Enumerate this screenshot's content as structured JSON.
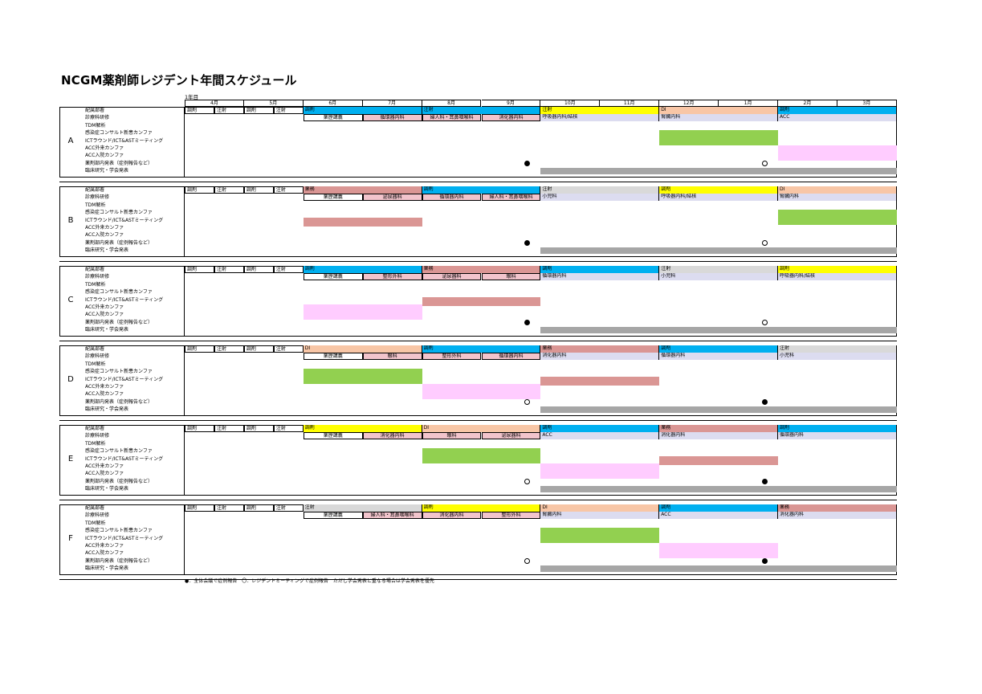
{
  "title": "NCGM薬剤師レジデント年間スケジュール",
  "year_label": "1年目",
  "months": [
    "4月",
    "5月",
    "6月",
    "7月",
    "8月",
    "9月",
    "10月",
    "11月",
    "12月",
    "1月",
    "2月",
    "3月"
  ],
  "row_labels": [
    "配属部署",
    "診療科研修",
    "TDM解析",
    "感染症コンサルト新患カンファ",
    "ICTラウンド/ICT&ASTミーティング",
    "ACC外来カンファ",
    "ACC入院カンファ",
    "薬剤部内発表（症例報告など）",
    "臨床研究・学会発表"
  ],
  "colors": {
    "blue": "#00b0f0",
    "yellow": "#ffff00",
    "salmon": "#f8c6a6",
    "rose": "#da9694",
    "lightgray": "#d9d9d9",
    "pink_cell": "#f2b8c6",
    "green": "#92d050",
    "lightpink": "#ffccff",
    "gray": "#a6a6a6",
    "lavender": "#dcdcf0"
  },
  "common_assignments": [
    "調剤",
    "注射",
    "調剤",
    "注射"
  ],
  "groups": [
    {
      "letter": "A",
      "assignments": [
        {
          "label": "調剤",
          "color": "blue"
        },
        {
          "label": "注射",
          "color": "blue"
        },
        {
          "label": "注射",
          "color": "yellow"
        },
        {
          "label": "DI",
          "color": "salmon"
        },
        {
          "label": "調剤",
          "color": "blue"
        }
      ],
      "rotations": [
        {
          "label": "薬歴講義",
          "style": "boxed"
        },
        {
          "label": "循環器内科",
          "style": "pink"
        },
        {
          "label": "婦人科・耳鼻咽喉科",
          "style": "pink"
        },
        {
          "label": "消化器内科",
          "style": "pink"
        },
        {
          "label": "呼吸器内科/結核",
          "style": "lav"
        },
        {
          "label": "腎臓内科",
          "style": "lav"
        },
        {
          "label": "ACC",
          "style": "lav"
        }
      ],
      "markers": [
        {
          "month": "9月",
          "type": "filled"
        },
        {
          "month": "1月",
          "type": "open"
        }
      ]
    },
    {
      "letter": "B",
      "assignments": [
        {
          "label": "薬務",
          "color": "rose"
        },
        {
          "label": "調剤",
          "color": "blue"
        },
        {
          "label": "注射",
          "color": "lightgray"
        },
        {
          "label": "調剤",
          "color": "yellow"
        },
        {
          "label": "DI",
          "color": "salmon"
        }
      ],
      "rotations": [
        {
          "label": "薬歴講義",
          "style": "boxed"
        },
        {
          "label": "泌尿器科",
          "style": "pink"
        },
        {
          "label": "循環器内科",
          "style": "pink"
        },
        {
          "label": "婦人科・耳鼻咽喉科",
          "style": "pink"
        },
        {
          "label": "小児科",
          "style": "lav"
        },
        {
          "label": "呼吸器内科/結核",
          "style": "lav"
        },
        {
          "label": "腎臓内科",
          "style": "lav"
        }
      ],
      "markers": [
        {
          "month": "9月",
          "type": "filled"
        },
        {
          "month": "1月",
          "type": "open"
        }
      ]
    },
    {
      "letter": "C",
      "assignments": [
        {
          "label": "調剤",
          "color": "blue"
        },
        {
          "label": "薬務",
          "color": "rose"
        },
        {
          "label": "調剤",
          "color": "blue"
        },
        {
          "label": "注射",
          "color": "lightgray"
        },
        {
          "label": "調剤",
          "color": "yellow"
        }
      ],
      "rotations": [
        {
          "label": "薬歴講義",
          "style": "boxed"
        },
        {
          "label": "整形外科",
          "style": "pink"
        },
        {
          "label": "泌尿器科",
          "style": "pink"
        },
        {
          "label": "眼科",
          "style": "pink"
        },
        {
          "label": "循環器内科",
          "style": "lav"
        },
        {
          "label": "小児科",
          "style": "lav"
        },
        {
          "label": "呼吸器内科/結核",
          "style": "lav"
        }
      ],
      "markers": [
        {
          "month": "9月",
          "type": "filled"
        },
        {
          "month": "1月",
          "type": "open"
        }
      ]
    },
    {
      "letter": "D",
      "assignments": [
        {
          "label": "DI",
          "color": "salmon"
        },
        {
          "label": "調剤",
          "color": "blue"
        },
        {
          "label": "薬務",
          "color": "rose"
        },
        {
          "label": "調剤",
          "color": "blue"
        },
        {
          "label": "注射",
          "color": "lightgray"
        }
      ],
      "rotations": [
        {
          "label": "薬歴講義",
          "style": "boxed"
        },
        {
          "label": "眼科",
          "style": "pink"
        },
        {
          "label": "整形外科",
          "style": "pink"
        },
        {
          "label": "循環器内科",
          "style": "pink"
        },
        {
          "label": "消化器内科",
          "style": "lav"
        },
        {
          "label": "循環器内科",
          "style": "lav"
        },
        {
          "label": "小児科",
          "style": "lav"
        }
      ],
      "markers": [
        {
          "month": "9月",
          "type": "open"
        },
        {
          "month": "1月",
          "type": "filled"
        }
      ]
    },
    {
      "letter": "E",
      "assignments": [
        {
          "label": "調剤",
          "color": "yellow"
        },
        {
          "label": "DI",
          "color": "salmon"
        },
        {
          "label": "調剤",
          "color": "blue"
        },
        {
          "label": "薬務",
          "color": "rose"
        },
        {
          "label": "調剤",
          "color": "blue"
        }
      ],
      "rotations": [
        {
          "label": "薬歴講義",
          "style": "boxed"
        },
        {
          "label": "消化器内科",
          "style": "pink"
        },
        {
          "label": "眼科",
          "style": "pink"
        },
        {
          "label": "泌尿器科",
          "style": "pink"
        },
        {
          "label": "ACC",
          "style": "lav"
        },
        {
          "label": "消化器内科",
          "style": "lav"
        },
        {
          "label": "循環器内科",
          "style": "lav"
        }
      ],
      "markers": [
        {
          "month": "9月",
          "type": "open"
        },
        {
          "month": "1月",
          "type": "filled"
        }
      ]
    },
    {
      "letter": "F",
      "assignments": [
        {
          "label": "注射",
          "color": "lightgray"
        },
        {
          "label": "調剤",
          "color": "yellow"
        },
        {
          "label": "DI",
          "color": "salmon"
        },
        {
          "label": "調剤",
          "color": "blue"
        },
        {
          "label": "薬務",
          "color": "rose"
        }
      ],
      "rotations": [
        {
          "label": "薬歴講義",
          "style": "boxed"
        },
        {
          "label": "婦人科・耳鼻咽喉科",
          "style": "pink"
        },
        {
          "label": "消化器内科",
          "style": "pink"
        },
        {
          "label": "整形外科",
          "style": "pink"
        },
        {
          "label": "腎臓内科",
          "style": "lav"
        },
        {
          "label": "ACC",
          "style": "lav"
        },
        {
          "label": "消化器内科",
          "style": "lav"
        }
      ],
      "markers": [
        {
          "month": "9月",
          "type": "open"
        },
        {
          "month": "1月",
          "type": "filled"
        }
      ]
    }
  ],
  "legend": "●：全体会議で症例報告　〇：レジデントミーティングで症例報告　ただし学会発表と重なる場合は学会発表を優先"
}
